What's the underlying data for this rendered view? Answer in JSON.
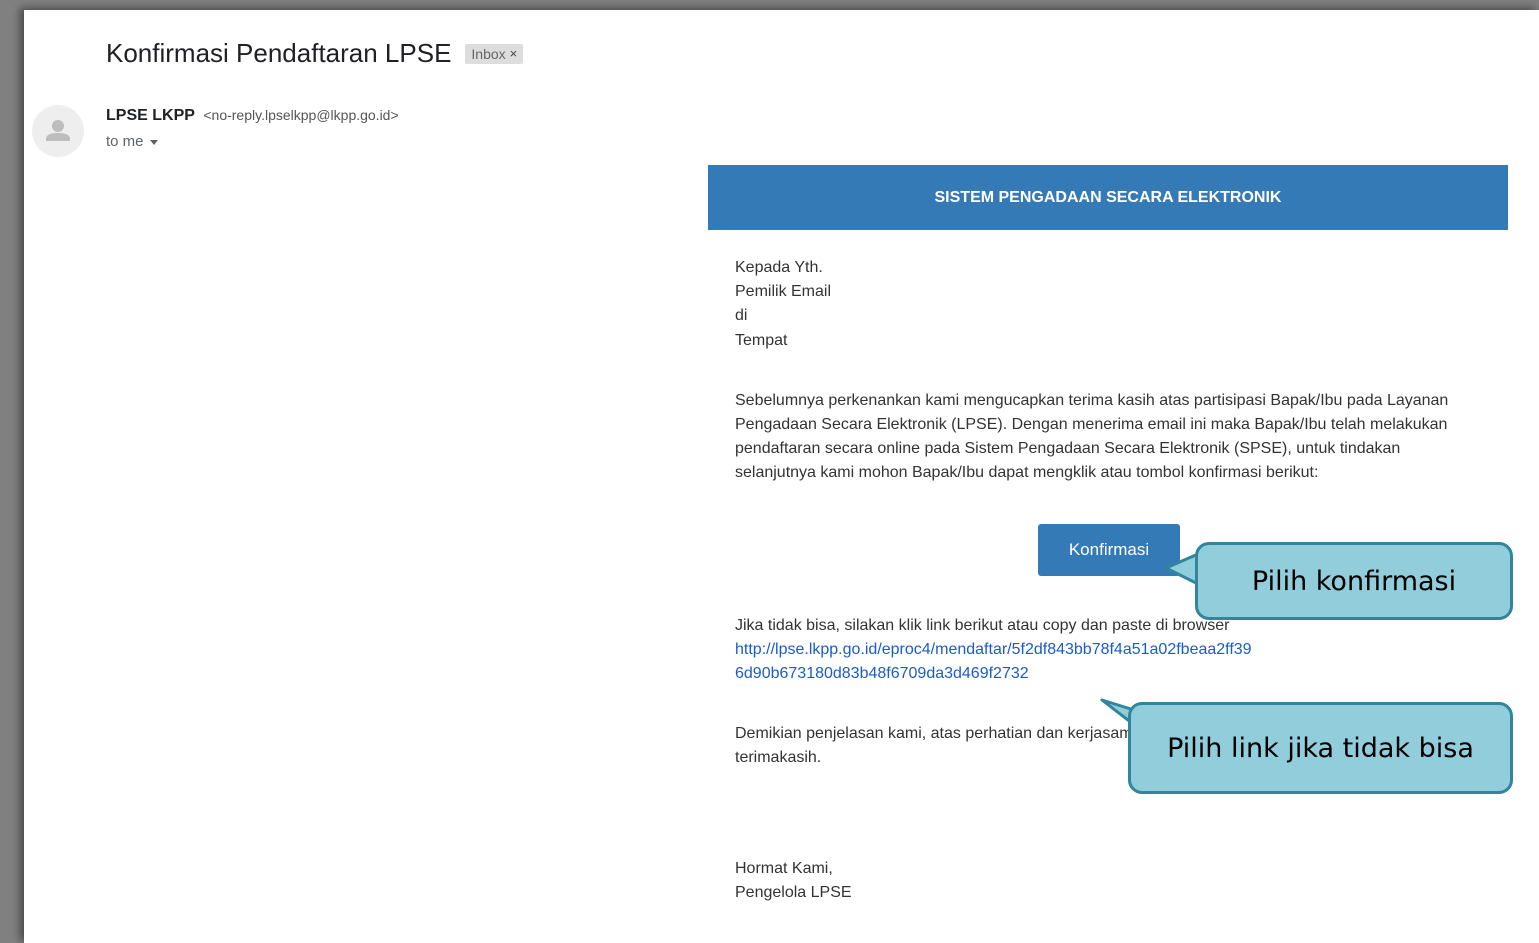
{
  "email": {
    "subject": "Konfirmasi Pendaftaran LPSE",
    "label": "Inbox",
    "label_close": "×",
    "sender_name": "LPSE LKPP",
    "sender_email": "<no-reply.lpselkpp@lkpp.go.id>",
    "recipient": "to me"
  },
  "content": {
    "header": "SISTEM PENGADAAN SECARA ELEKTRONIK",
    "greeting": [
      "Kepada Yth.",
      "Pemilik Email",
      "di",
      "Tempat"
    ],
    "paragraph1": "Sebelumnya perkenankan kami mengucapkan terima kasih atas partisipasi Bapak/Ibu pada Layanan Pengadaan Secara Elektronik (LPSE). Dengan menerima email ini maka Bapak/Ibu telah melakukan pendaftaran secara online pada Sistem Pengadaan Secara Elektronik (SPSE), untuk tindakan selanjutnya kami mohon Bapak/Ibu dapat mengklik atau tombol konfirmasi berikut:",
    "confirm_button": "Konfirmasi",
    "paragraph2": "Jika tidak bisa, silakan klik link berikut atau copy dan paste di browser",
    "link_line1": "http://lpse.lkpp.go.id/eproc4/mendaftar/5f2df843bb78f4a51a02fbeaa2ff39",
    "link_line2": "6d90b673180d83b48f6709da3d469f2732",
    "paragraph3_line1": "Demikian penjelasan kami, atas perhatian dan kerjasamanya",
    "paragraph3_line2": "terimakasih.",
    "closing": [
      "Hormat Kami,",
      "Pengelola LPSE"
    ]
  },
  "callouts": {
    "confirm": "Pilih konfirmasi",
    "link": "Pilih link jika tidak bisa"
  },
  "colors": {
    "header_blue": "#337ab7",
    "callout_fill": "#92cddc",
    "callout_border": "#31859c",
    "link": "#1a5cc8"
  }
}
